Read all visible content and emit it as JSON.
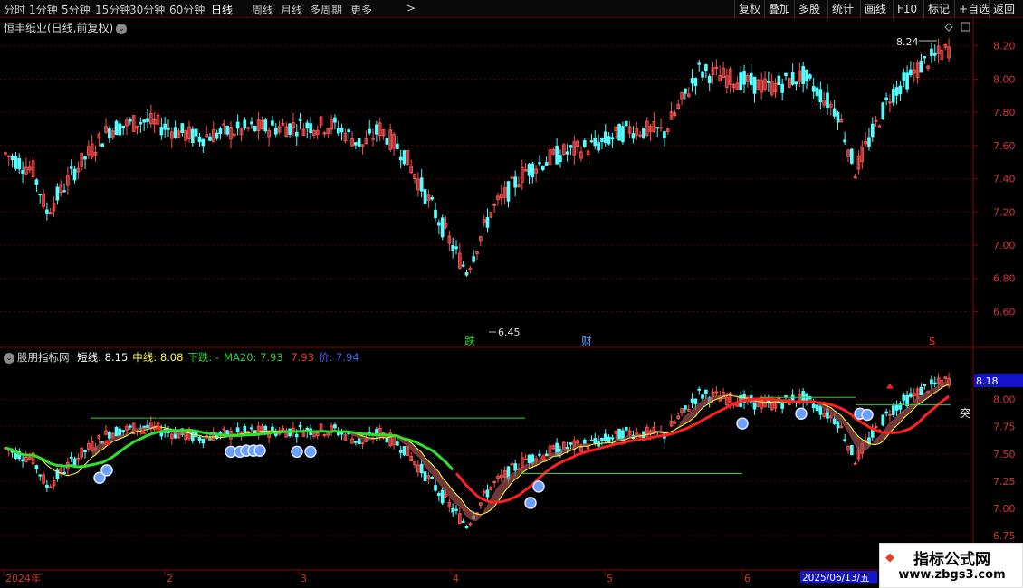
{
  "toolbar": {
    "periods": [
      "分时",
      "1分钟",
      "5分钟",
      "15分钟",
      "30分钟",
      "60分钟",
      "日线",
      "周线",
      "月线",
      "多周期",
      "更多"
    ],
    "more_arrow": ">",
    "right_buttons": [
      "复权",
      "叠加",
      "多股",
      "统计",
      "画线",
      "F10",
      "标记",
      "+自选",
      "返回"
    ]
  },
  "main_pane": {
    "title": "恒丰纸业(日线,前复权)",
    "high_label": "8.24",
    "low_label": "6.45",
    "event_labels": [
      {
        "text": "跌",
        "color": "#30d030"
      },
      {
        "text": "财",
        "color": "#40a0ff"
      },
      {
        "text": "$",
        "color": "#ff3030"
      }
    ],
    "y_ticks": [
      "8.20",
      "8.00",
      "7.80",
      "7.60",
      "7.40",
      "7.20",
      "7.00",
      "6.80",
      "6.60"
    ]
  },
  "indicator_pane": {
    "name": "股朋指标网",
    "items": [
      {
        "label": "短线:",
        "value": "8.15",
        "color": "#ffffff"
      },
      {
        "label": "中线:",
        "value": "8.08",
        "color": "#ffff40"
      },
      {
        "label": "下跌:",
        "value": "-",
        "color": "#30d030"
      },
      {
        "label": "MA20:",
        "value": "7.93",
        "color": "#30d030"
      },
      {
        "label": "",
        "value": "7.93",
        "color": "#ff3030"
      },
      {
        "label": "价:",
        "value": "7.94",
        "color": "#4060ff"
      }
    ],
    "current_value": "8.18",
    "breakout_label": "突",
    "y_ticks": [
      "8.00",
      "7.75",
      "7.50",
      "7.25",
      "7.00",
      "6.75"
    ]
  },
  "x_axis": {
    "labels": [
      "2024年",
      "2",
      "3",
      "4",
      "5",
      "6"
    ],
    "cursor_date": "2025/06/13/五"
  },
  "colors": {
    "up": "#ff5050",
    "down": "#54ffff",
    "grid": "#5a0000",
    "axis_text": "#d83030"
  },
  "watermark": {
    "title": "指标公式网",
    "url": "www.zbgs3.com"
  }
}
